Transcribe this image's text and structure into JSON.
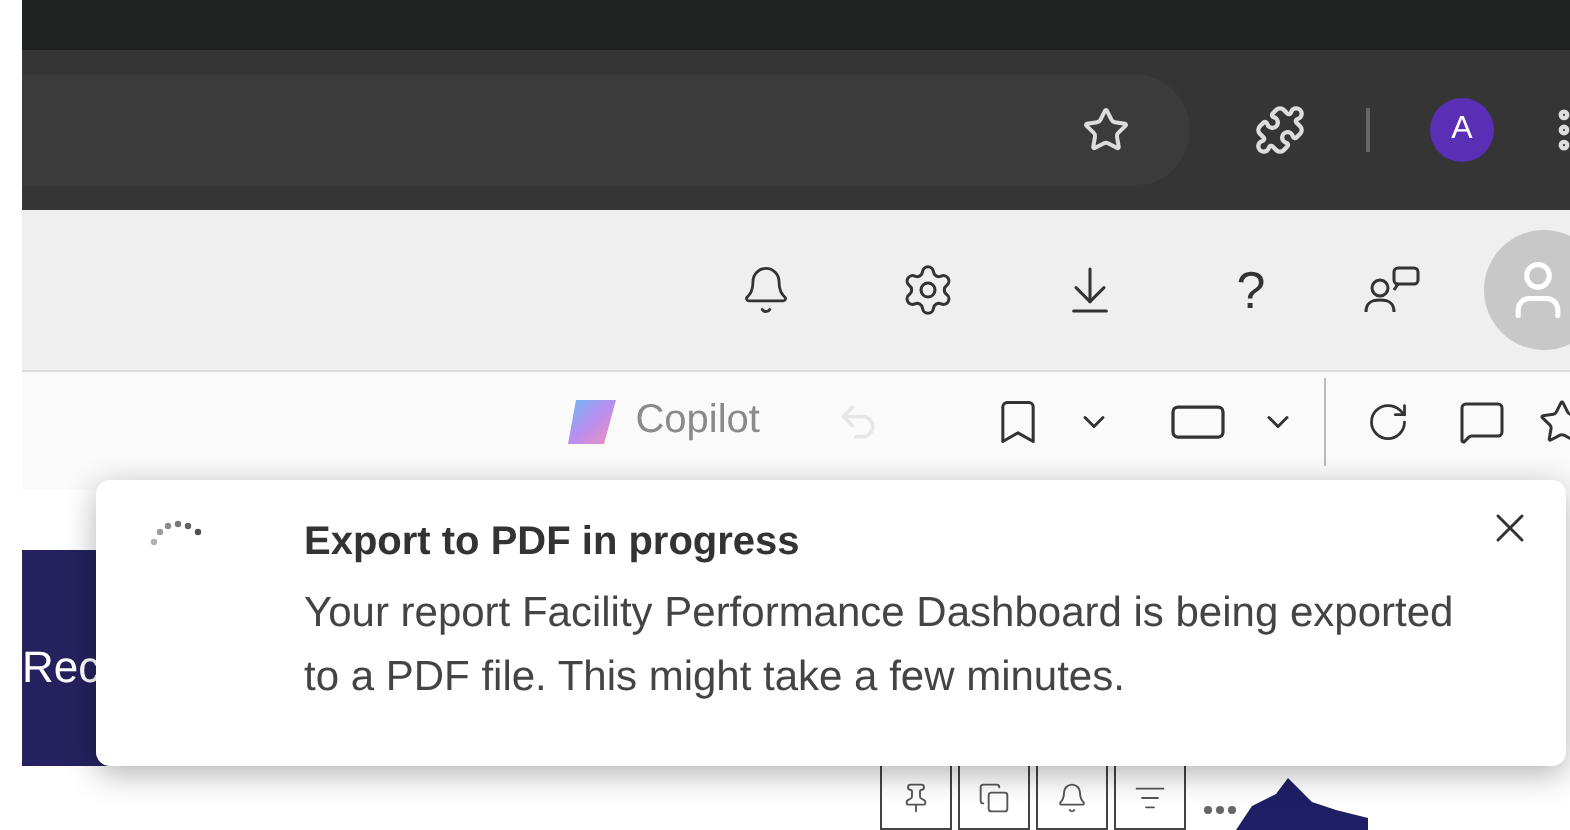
{
  "browser": {
    "profile_initial": "A"
  },
  "app_header": {
    "help": "?"
  },
  "toolbar": {
    "copilot": "Copilot",
    "undo_disabled": true
  },
  "banner": {
    "text": "Rec"
  },
  "toast": {
    "title": "Export to PDF in progress",
    "message": "Your report Facility Performance Dashboard is being exported to a PDF file. This might take a few minutes."
  }
}
